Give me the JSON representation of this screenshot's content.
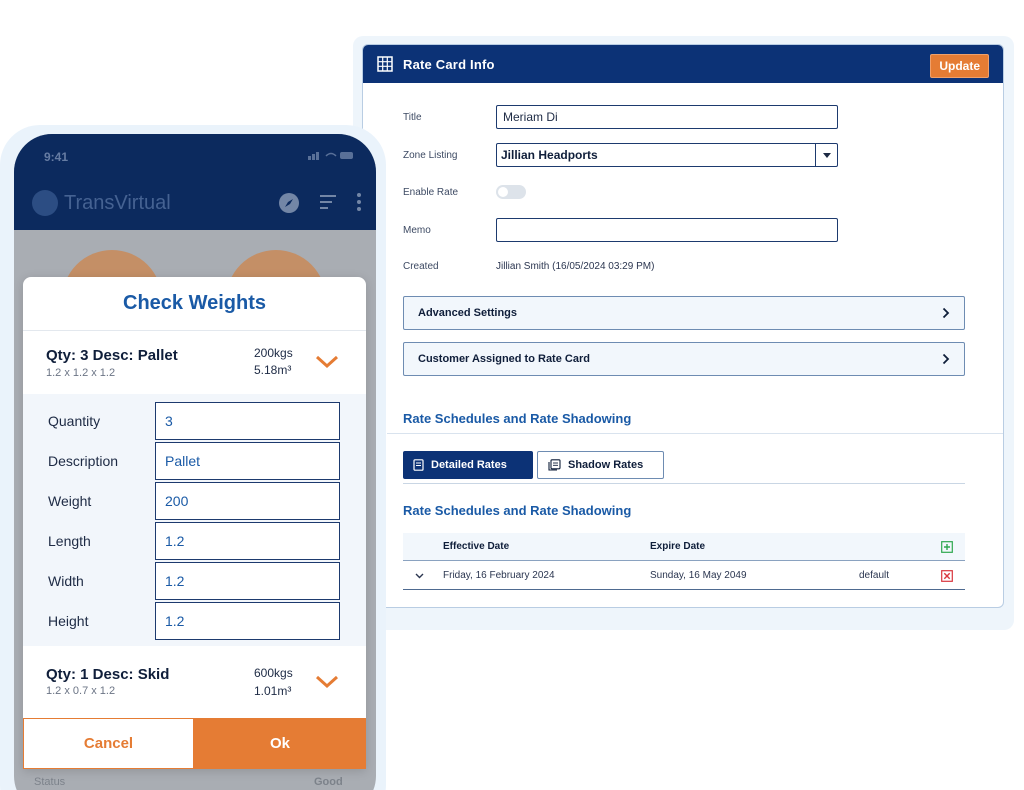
{
  "desktop": {
    "header": {
      "title": "Rate Card Info",
      "update_label": "Update"
    },
    "form": {
      "title_label": "Title",
      "title_value": "Meriam Di",
      "zone_label": "Zone Listing",
      "zone_value": "Jillian Headports",
      "enable_label": "Enable Rate",
      "enable_value": "off",
      "memo_label": "Memo",
      "memo_value": "",
      "created_label": "Created",
      "created_value": "Jillian Smith (16/05/2024 03:29 PM)"
    },
    "accordions": [
      {
        "label": "Advanced Settings"
      },
      {
        "label": "Customer Assigned to Rate Card"
      }
    ],
    "section_title": "Rate Schedules and Rate Shadowing",
    "tabs": [
      {
        "label": "Detailed Rates",
        "active": true
      },
      {
        "label": "Shadow Rates",
        "active": false
      }
    ],
    "sub_title": "Rate Schedules and Rate Shadowing",
    "table": {
      "columns": [
        "Effective Date",
        "Expire Date"
      ],
      "rows": [
        {
          "effective": "Friday, 16 February 2024",
          "expire": "Sunday, 16 May 2049",
          "type": "default"
        }
      ]
    }
  },
  "phone": {
    "status_time": "9:41",
    "brand": "TransVirtual",
    "modal": {
      "title": "Check Weights",
      "items": [
        {
          "name": "Qty: 3 Desc: Pallet",
          "dims": "1.2 x 1.2 x 1.2",
          "weight": "200kgs",
          "volume": "5.18m³"
        },
        {
          "name": "Qty: 1 Desc: Skid",
          "dims": "1.2 x 0.7 x 1.2",
          "weight": "600kgs",
          "volume": "1.01m³"
        }
      ],
      "fields": [
        {
          "label": "Quantity",
          "value": "3"
        },
        {
          "label": "Description",
          "value": "Pallet"
        },
        {
          "label": "Weight",
          "value": "200"
        },
        {
          "label": "Length",
          "value": "1.2"
        },
        {
          "label": "Width",
          "value": "1.2"
        },
        {
          "label": "Height",
          "value": "1.2"
        }
      ],
      "cancel_label": "Cancel",
      "ok_label": "Ok"
    },
    "under": {
      "status_label": "Status",
      "status_value": "Good"
    }
  },
  "colors": {
    "navy": "#0c3276",
    "accent_orange": "#e57c34",
    "link_blue": "#1a5aa6",
    "add_green": "#2fa84f",
    "delete_red": "#d9363e"
  }
}
